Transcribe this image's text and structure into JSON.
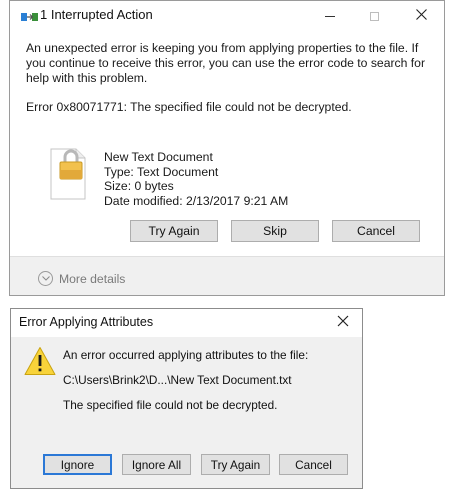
{
  "dialog1": {
    "title": "1 Interrupted Action",
    "message": "An unexpected error is keeping you from applying properties to the file. If you continue to receive this error, you can use the error code to search for help with this problem.",
    "error": "Error 0x80071771: The specified file could not be decrypted.",
    "file": {
      "name": "New Text Document",
      "type": "Type: Text Document",
      "size": "Size: 0 bytes",
      "modified": "Date modified: 2/13/2017 9:21 AM"
    },
    "buttons": {
      "try_again": "Try Again",
      "skip": "Skip",
      "cancel": "Cancel"
    },
    "more_details": "More details",
    "icons": [
      "copy-progress-icon",
      "minimize-icon",
      "maximize-icon",
      "close-icon",
      "locked-file-icon",
      "chevron-down-icon"
    ]
  },
  "dialog2": {
    "title": "Error Applying Attributes",
    "line1": "An error occurred applying attributes to the file:",
    "path": "C:\\Users\\Brink2\\D...\\New Text Document.txt",
    "line3": "The specified file could not be decrypted.",
    "buttons": {
      "ignore": "Ignore",
      "ignore_all": "Ignore All",
      "try_again": "Try Again",
      "cancel": "Cancel"
    },
    "icons": [
      "close-icon",
      "warning-icon"
    ],
    "focus_color": "#2b78d6"
  }
}
